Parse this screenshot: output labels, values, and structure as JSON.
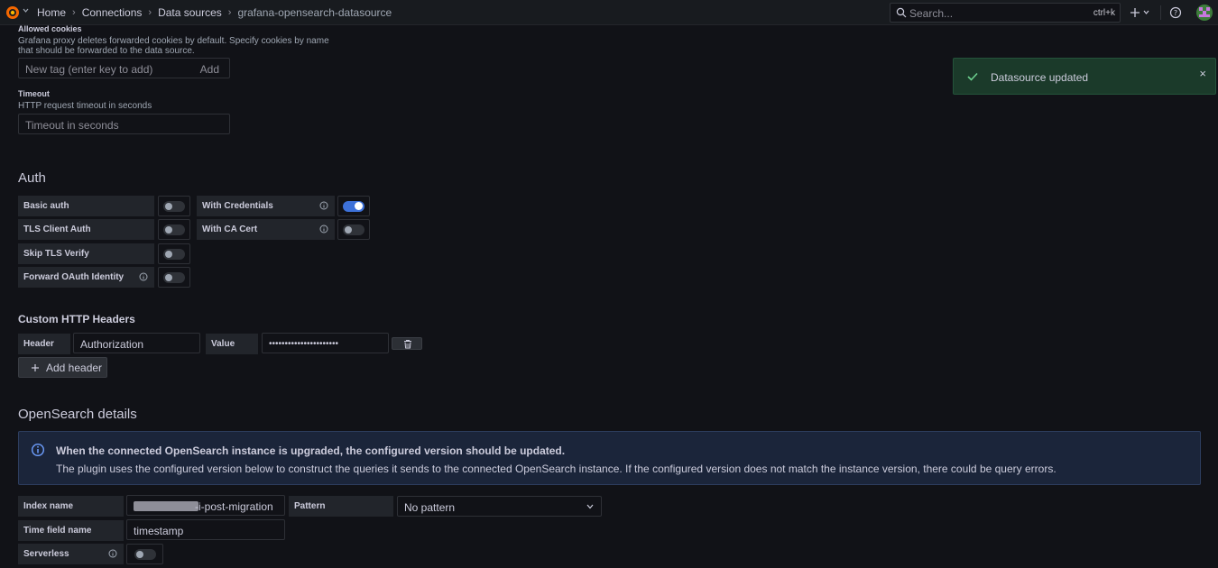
{
  "topbar": {
    "breadcrumbs": [
      "Home",
      "Connections",
      "Data sources",
      "grafana-opensearch-datasource"
    ],
    "search_placeholder": "Search...",
    "search_shortcut": "ctrl+k"
  },
  "allowed_cookies": {
    "label": "Allowed cookies",
    "description_line1": "Grafana proxy deletes forwarded cookies by default. Specify cookies by name",
    "description_line2": "that should be forwarded to the data source.",
    "placeholder": "New tag (enter key to add)",
    "add_label": "Add"
  },
  "timeout": {
    "label": "Timeout",
    "description": "HTTP request timeout in seconds",
    "placeholder": "Timeout in seconds"
  },
  "auth": {
    "heading": "Auth",
    "toggles": [
      {
        "label": "Basic auth",
        "on": false
      },
      {
        "label": "TLS Client Auth",
        "on": false
      },
      {
        "label": "Skip TLS Verify",
        "on": false
      },
      {
        "label": "Forward OAuth Identity",
        "on": false
      },
      {
        "label": "With Credentials",
        "on": true
      },
      {
        "label": "With CA Cert",
        "on": false
      }
    ]
  },
  "headers": {
    "heading": "Custom HTTP Headers",
    "header_label": "Header",
    "header_value": "Authorization",
    "value_label": "Value",
    "value_masked": "••••••••••••••••••••••",
    "add_header_label": "Add header"
  },
  "opensearch": {
    "heading": "OpenSearch details",
    "alert_title": "When the connected OpenSearch instance is upgraded, the configured version should be updated.",
    "alert_body": "The plugin uses the configured version below to construct the queries it sends to the connected OpenSearch instance. If the configured version does not match the instance version, there could be query errors.",
    "index_name_label": "Index name",
    "index_name_value": "-i-post-migration",
    "pattern_label": "Pattern",
    "pattern_value": "No pattern",
    "time_field_label": "Time field name",
    "time_field_value": "timestamp",
    "serverless_label": "Serverless",
    "serverless_on": false
  },
  "toast": {
    "message": "Datasource updated"
  },
  "colors": {
    "accent_blue": "#3d71d9",
    "success_green": "#1b3a2a",
    "info_blue": "#1b253a"
  }
}
